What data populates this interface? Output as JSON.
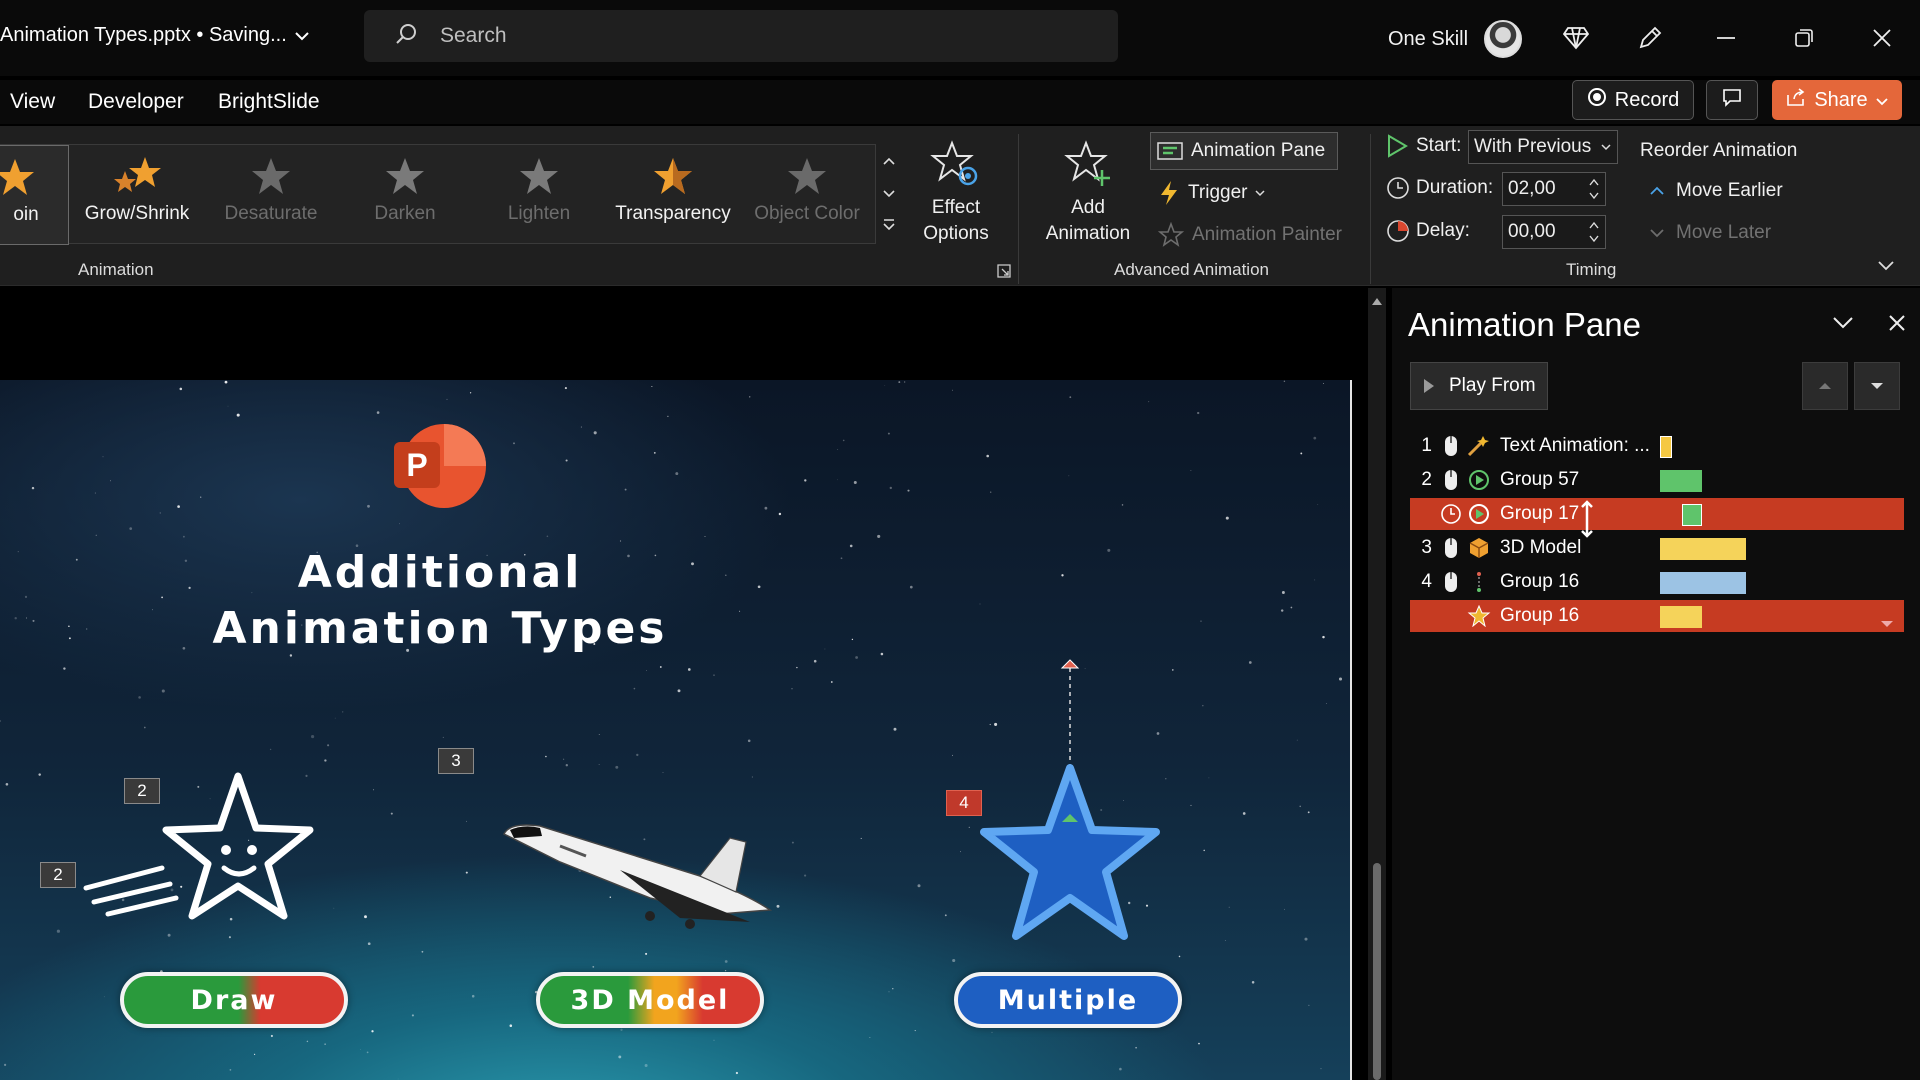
{
  "titlebar": {
    "doc_title": "Animation Types.pptx • Saving...",
    "search_placeholder": "Search",
    "account_name": "One Skill"
  },
  "tabs": [
    "View",
    "Developer",
    "BrightSlide"
  ],
  "actions": {
    "record": "Record",
    "share": "Share"
  },
  "ribbon": {
    "gallery": [
      {
        "label": "oin",
        "enabled": true
      },
      {
        "label": "Grow/Shrink",
        "enabled": true
      },
      {
        "label": "Desaturate",
        "enabled": false
      },
      {
        "label": "Darken",
        "enabled": false
      },
      {
        "label": "Lighten",
        "enabled": false
      },
      {
        "label": "Transparency",
        "enabled": true
      },
      {
        "label": "Object Color",
        "enabled": false
      }
    ],
    "effect_options": [
      "Effect",
      "Options"
    ],
    "animation_group": "Animation",
    "add_animation": [
      "Add",
      "Animation"
    ],
    "animation_pane_btn": "Animation Pane",
    "trigger": "Trigger",
    "animation_painter": "Animation Painter",
    "advanced_group": "Advanced Animation",
    "start_label": "Start:",
    "start_value": "With Previous",
    "duration_label": "Duration:",
    "duration_value": "02,00",
    "delay_label": "Delay:",
    "delay_value": "00,00",
    "timing_group": "Timing",
    "reorder_title": "Reorder Animation",
    "move_earlier": "Move Earlier",
    "move_later": "Move Later"
  },
  "slide": {
    "title_line1": "Additional",
    "title_line2": "Animation Types",
    "buttons": [
      "Draw",
      "3D Model",
      "Multiple"
    ],
    "tags": [
      "2",
      "2",
      "3",
      "4"
    ]
  },
  "pane": {
    "title": "Animation Pane",
    "play_from": "Play From",
    "rows": [
      {
        "num": "1",
        "name": "Text Animation: ...",
        "selected": false,
        "bar_color": "#f5c842"
      },
      {
        "num": "2",
        "name": "Group 57",
        "selected": false,
        "bar_color": "#5fc46b"
      },
      {
        "num": "",
        "name": "Group 17",
        "selected": true,
        "bar_color": "#5fc46b"
      },
      {
        "num": "3",
        "name": "3D Model",
        "selected": false,
        "bar_color": "#f5d35a"
      },
      {
        "num": "4",
        "name": "Group 16",
        "selected": false,
        "bar_color": "#9cc3e4"
      },
      {
        "num": "",
        "name": "Group 16",
        "selected": true,
        "bar_color": "#f5d35a"
      }
    ]
  },
  "colors": {
    "accent": "#c63b22",
    "share": "#e4673a",
    "draw_pill": [
      "#2a9a3c",
      "#d83a30"
    ],
    "model_pill": [
      "#2a9a3c",
      "#f2a41e",
      "#d83a30"
    ],
    "multiple_pill": "#1e5fc2"
  }
}
